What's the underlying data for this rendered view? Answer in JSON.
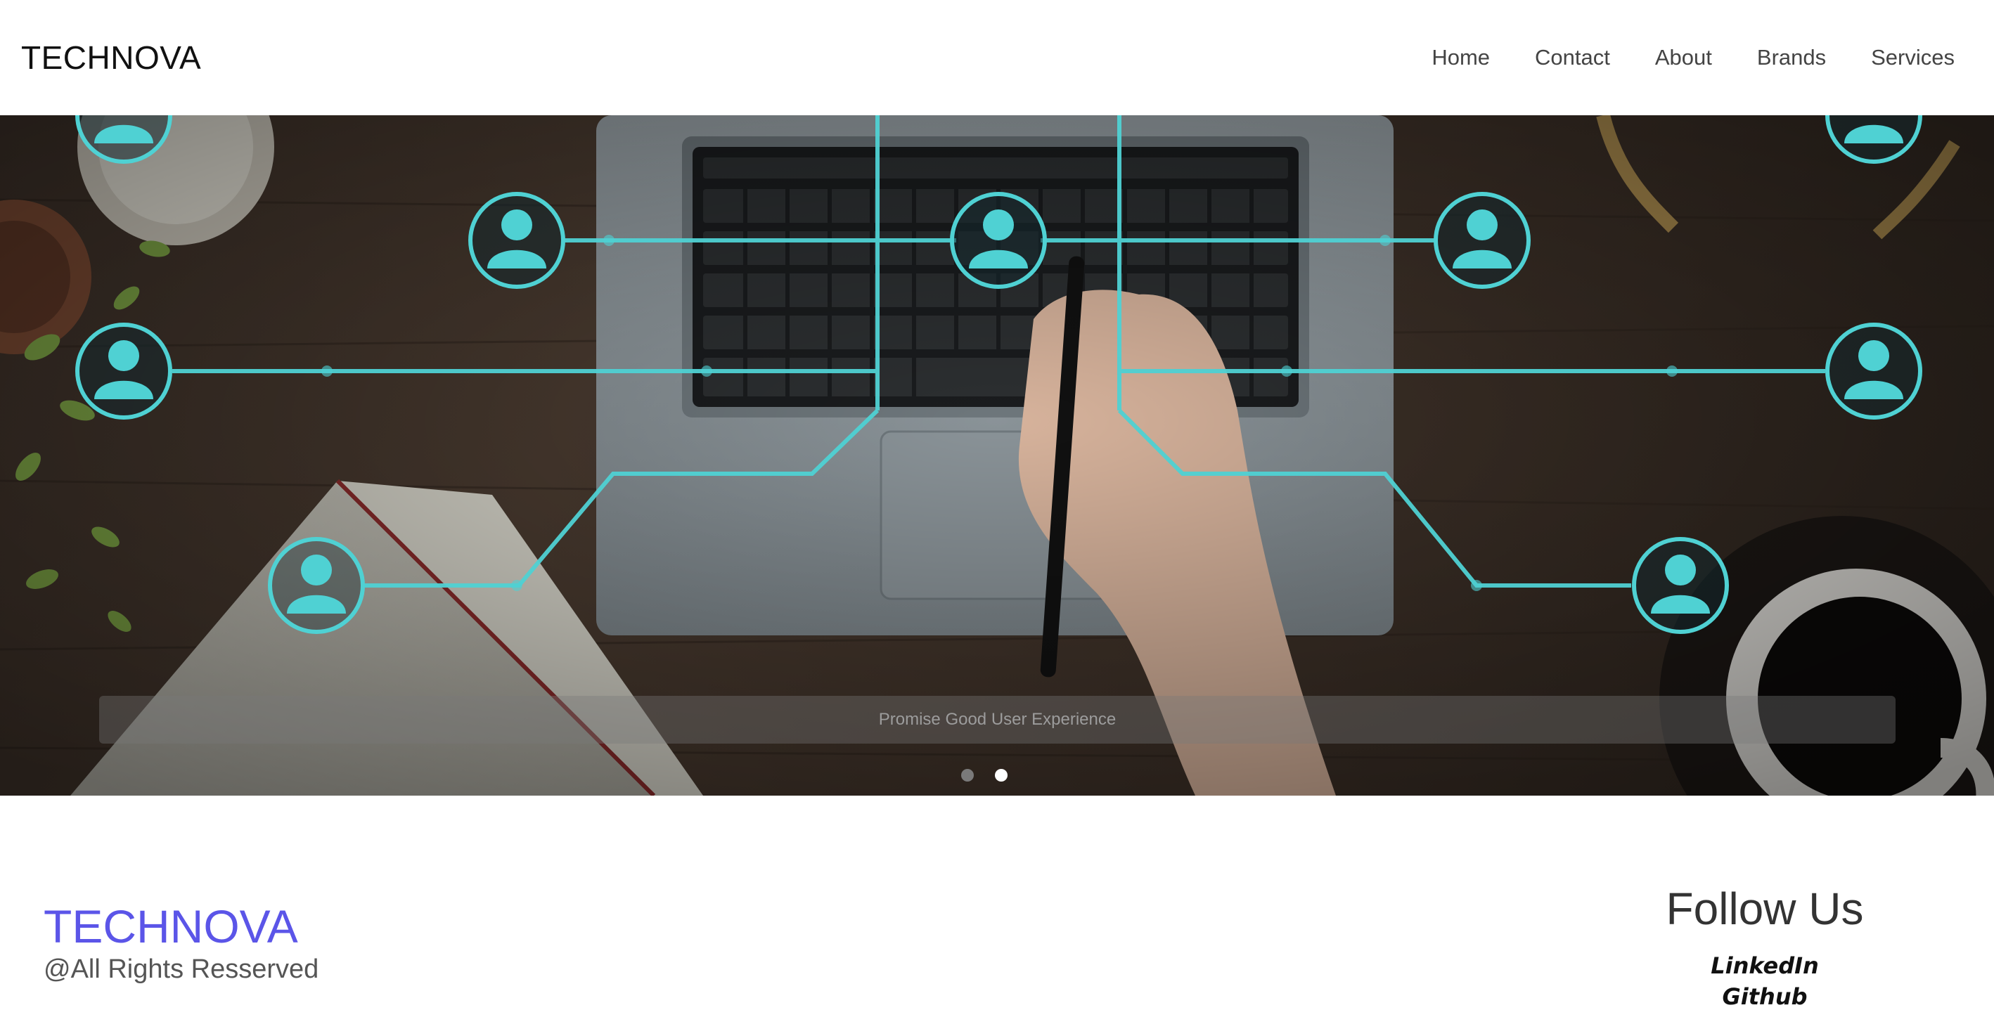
{
  "header": {
    "brand": "TECHNOVA",
    "nav": [
      "Home",
      "Contact",
      "About",
      "Brands",
      "Services"
    ]
  },
  "hero": {
    "caption": "Promise Good User Experience",
    "slides_total": 2,
    "active_slide": 2,
    "accent_color": "#4fd1d3",
    "icons": [
      "user-icon"
    ]
  },
  "footer": {
    "brand": "TECHNOVA",
    "rights": "@All Rights Resserved",
    "follow_title": "Follow Us",
    "links": [
      "LinkedIn",
      "Github"
    ]
  },
  "colors": {
    "brand_footer": "#5b55e8",
    "nav_text": "#444444",
    "hero_overlay_accent": "#4fd1d3"
  }
}
